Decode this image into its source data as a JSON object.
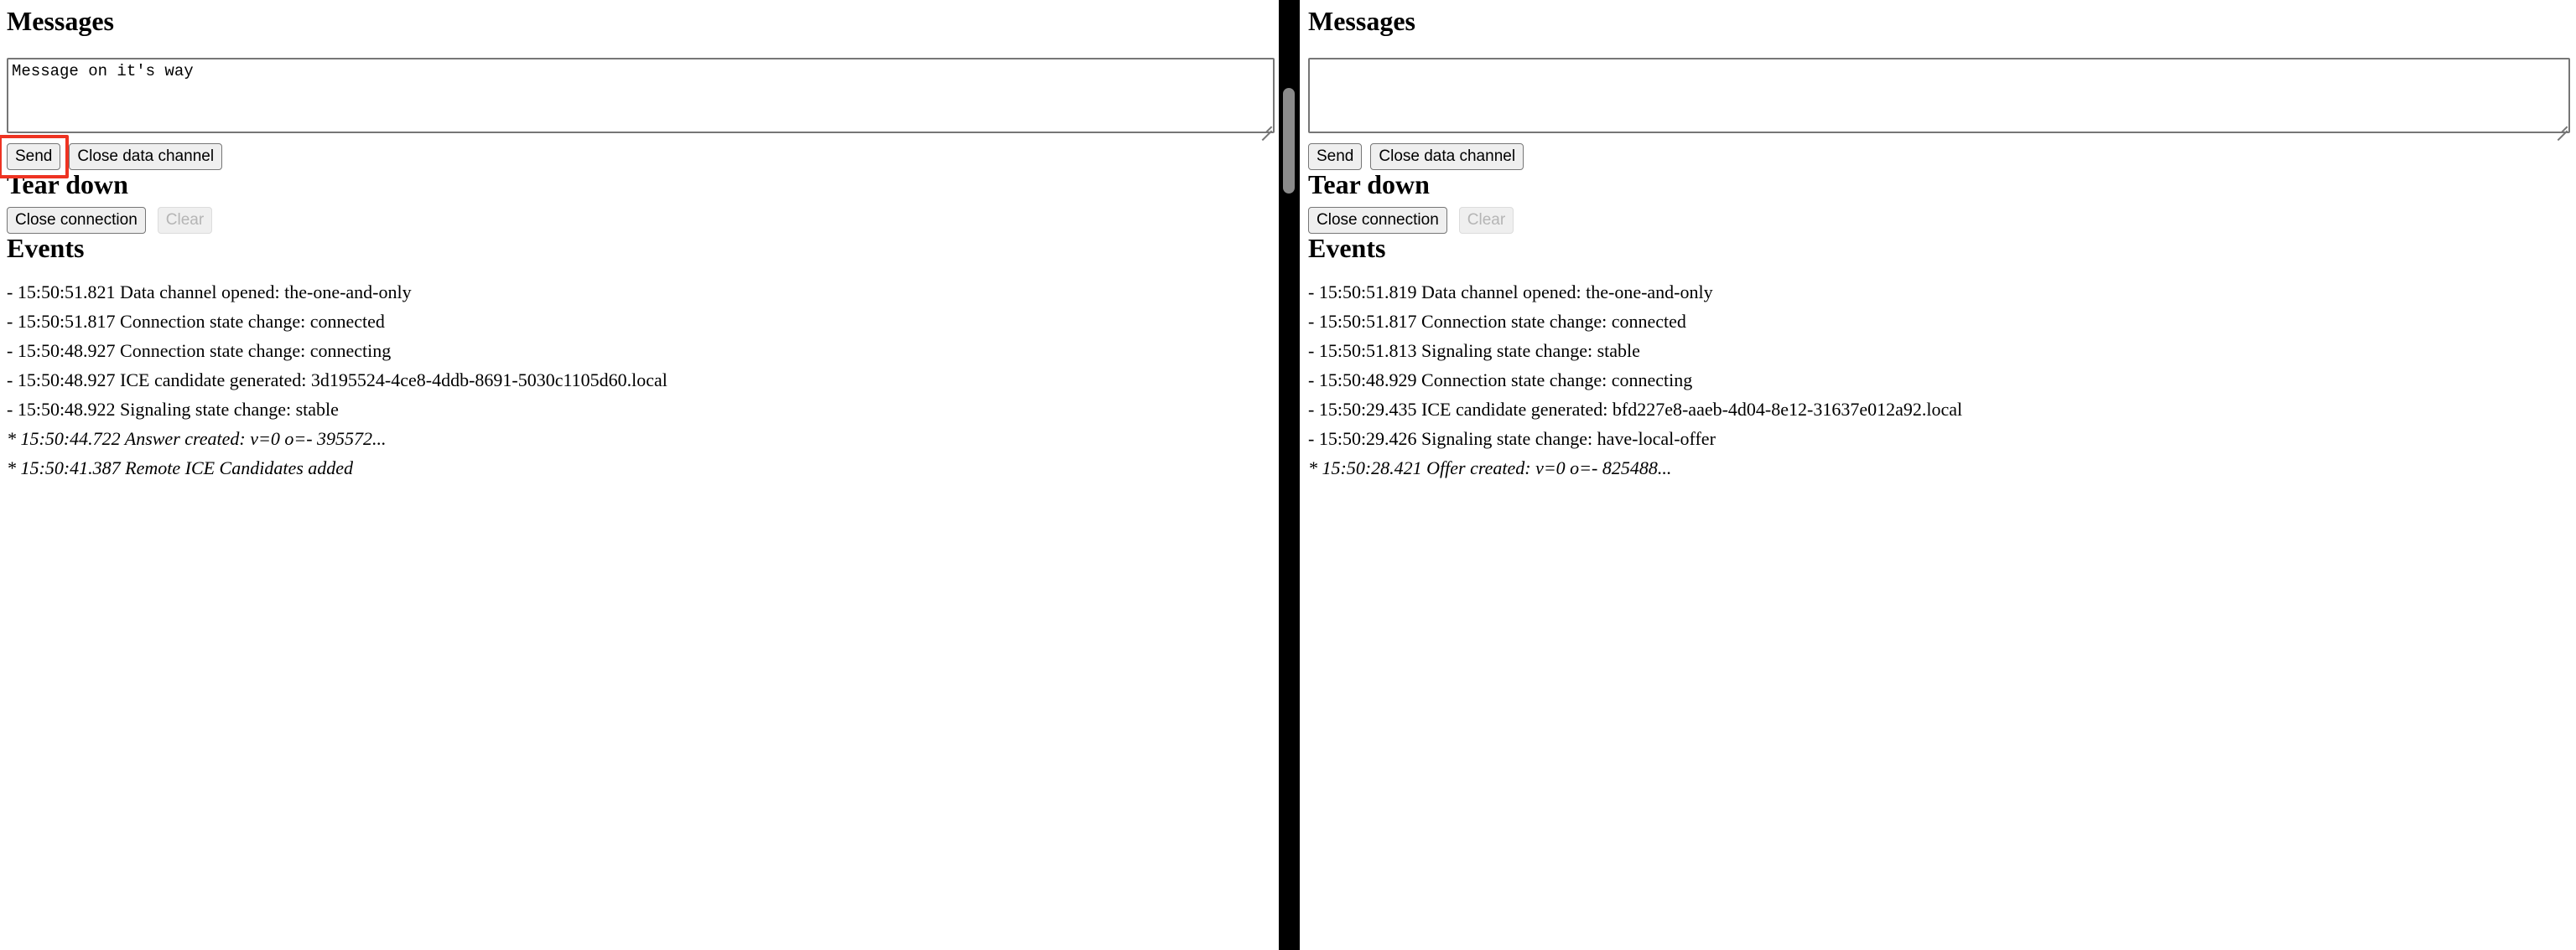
{
  "panes": [
    {
      "id": "left",
      "messages": {
        "heading": "Messages",
        "textarea_value": "Message on it's way",
        "textarea_placeholder": "",
        "send_label": "Send",
        "close_channel_label": "Close data channel",
        "send_highlighted": true
      },
      "teardown": {
        "heading": "Tear down",
        "close_connection_label": "Close connection",
        "clear_label": "Clear",
        "clear_disabled": true
      },
      "events": {
        "heading": "Events",
        "items": [
          {
            "text": "- 15:50:51.821 Data channel opened: the-one-and-only",
            "emphasis": false
          },
          {
            "text": "- 15:50:51.817 Connection state change: connected",
            "emphasis": false
          },
          {
            "text": "- 15:50:48.927 Connection state change: connecting",
            "emphasis": false
          },
          {
            "text": "- 15:50:48.927 ICE candidate generated: 3d195524-4ce8-4ddb-8691-5030c1105d60.local",
            "emphasis": false
          },
          {
            "text": "- 15:50:48.922 Signaling state change: stable",
            "emphasis": false
          },
          {
            "text": "* 15:50:44.722 Answer created: v=0 o=- 395572...",
            "emphasis": true
          },
          {
            "text": "* 15:50:41.387 Remote ICE Candidates added",
            "emphasis": true
          }
        ]
      }
    },
    {
      "id": "right",
      "messages": {
        "heading": "Messages",
        "textarea_value": "",
        "textarea_placeholder": "",
        "send_label": "Send",
        "close_channel_label": "Close data channel",
        "send_highlighted": false
      },
      "teardown": {
        "heading": "Tear down",
        "close_connection_label": "Close connection",
        "clear_label": "Clear",
        "clear_disabled": true
      },
      "events": {
        "heading": "Events",
        "items": [
          {
            "text": "- 15:50:51.819 Data channel opened: the-one-and-only",
            "emphasis": false
          },
          {
            "text": "- 15:50:51.817 Connection state change: connected",
            "emphasis": false
          },
          {
            "text": "- 15:50:51.813 Signaling state change: stable",
            "emphasis": false
          },
          {
            "text": "- 15:50:48.929 Connection state change: connecting",
            "emphasis": false
          },
          {
            "text": "- 15:50:29.435 ICE candidate generated: bfd227e8-aaeb-4d04-8e12-31637e012a92.local",
            "emphasis": false
          },
          {
            "text": "- 15:50:29.426 Signaling state change: have-local-offer",
            "emphasis": false
          },
          {
            "text": "* 15:50:28.421 Offer created: v=0 o=- 825488...",
            "emphasis": true
          }
        ]
      }
    }
  ],
  "colors": {
    "highlight": "#ee3322",
    "divider": "#000000",
    "scrollbar_thumb": "#8a8a8a",
    "button_face": "#efefef",
    "button_border": "#767676",
    "disabled_text": "#b5b5b5"
  }
}
